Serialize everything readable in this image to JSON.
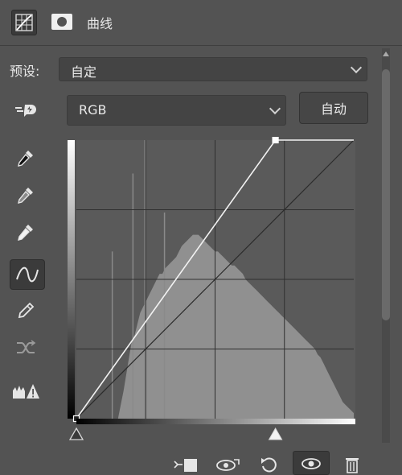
{
  "panel": {
    "title": "曲线",
    "header_icons": [
      "curves-adjustment-icon",
      "mask-icon"
    ]
  },
  "preset": {
    "label": "预设:",
    "value": "自定"
  },
  "channel": {
    "value": "RGB"
  },
  "auto_button": {
    "label": "自动"
  },
  "tools": [
    {
      "name": "on-image-adjust-icon",
      "selected": false
    },
    {
      "name": "black-point-eyedropper-icon",
      "selected": false
    },
    {
      "name": "gray-point-eyedropper-icon",
      "selected": false
    },
    {
      "name": "white-point-eyedropper-icon",
      "selected": false
    },
    {
      "name": "curve-point-icon",
      "selected": true
    },
    {
      "name": "pencil-icon",
      "selected": false
    },
    {
      "name": "smooth-icon",
      "selected": false
    },
    {
      "name": "clipping-warning-icon",
      "selected": false
    }
  ],
  "curve": {
    "input_range": [
      0,
      255
    ],
    "output_range": [
      0,
      255
    ],
    "points": [
      [
        0,
        0
      ],
      [
        183,
        255
      ]
    ],
    "grid_divisions": 4,
    "black_input": 0,
    "white_input": 183
  },
  "histogram": {
    "spikes_at": [
      33,
      52,
      63,
      81
    ],
    "profile": [
      0,
      0,
      0,
      0,
      0,
      0,
      0,
      0,
      0,
      0,
      0,
      0,
      0,
      0,
      0,
      0,
      5,
      10,
      16,
      22,
      28,
      30,
      34,
      38,
      40,
      42,
      44,
      46,
      48,
      50,
      52,
      52,
      54,
      55,
      56,
      57,
      58,
      60,
      62,
      63,
      64,
      65,
      66,
      66,
      66,
      65,
      64,
      63,
      62,
      61,
      60,
      60,
      59,
      58,
      57,
      56,
      55,
      55,
      54,
      53,
      52,
      50,
      49,
      48,
      47,
      46,
      45,
      44,
      43,
      42,
      41,
      40,
      39,
      38,
      37,
      36,
      35,
      34,
      33,
      32,
      31,
      30,
      29,
      28,
      27,
      26,
      25,
      23,
      22,
      20,
      18,
      16,
      14,
      12,
      10,
      8,
      6,
      5,
      4,
      3,
      2
    ]
  },
  "colors": {
    "panel_bg": "#535353",
    "graph_bg": "#5a5a5a",
    "histogram": "#909090",
    "grid": "#2f2f2f",
    "curve": "#f2f2f2"
  },
  "bottom_toolbar": [
    "clip-to-layer-icon",
    "view-previous-state-icon",
    "reset-icon",
    "toggle-visibility-icon",
    "delete-icon"
  ]
}
